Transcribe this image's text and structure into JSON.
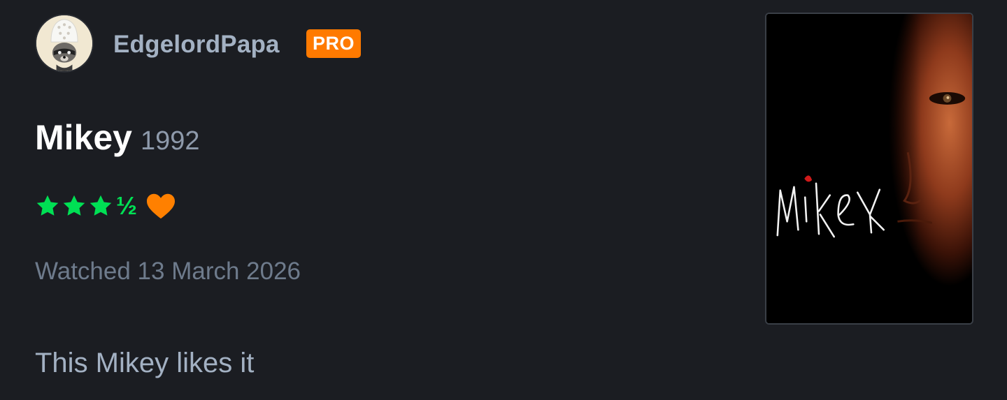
{
  "user": {
    "username": "EdgelordPapa",
    "badge": "PRO",
    "avatar_icon": "raccoon-in-crocs-avatar"
  },
  "film": {
    "title": "Mikey",
    "year": "1992",
    "poster_title_text": "Mikey"
  },
  "rating": {
    "stars": 3.5,
    "liked": true,
    "half_glyph": "½",
    "star_color": "#00e054",
    "heart_color": "#ff8000"
  },
  "watched_label": "Watched 13 March 2026",
  "review_text": "This Mikey likes it",
  "colors": {
    "background": "#1b1d22",
    "badge": "#ff7a00",
    "username": "#a3b1c3",
    "muted": "#6e7b8c"
  }
}
